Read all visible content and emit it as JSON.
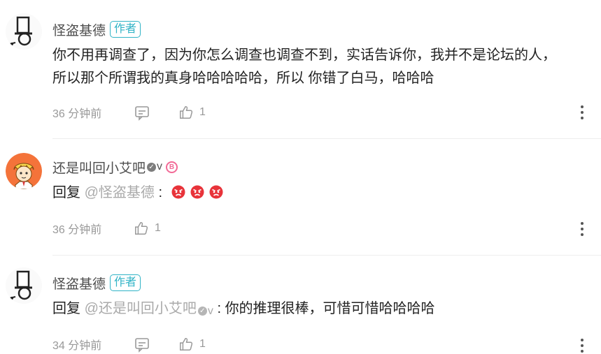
{
  "comments": [
    {
      "author": "怪盗基德",
      "badge": "作者",
      "text_line1": "你不用再调查了，因为你怎么调查也调查不到，实话告诉你，我并不是论坛的人，",
      "text_line2": "所以那个所谓我的真身哈哈哈哈哈，所以 你错了白马，哈哈哈",
      "time": "36 分钟前",
      "likes": "1"
    },
    {
      "author": "还是叫回小艾吧",
      "v_mark": "v",
      "level_badge": "B",
      "reply_prefix": "回复",
      "mention": "@怪盗基德",
      "separator": ":",
      "emoji_count": 3,
      "emoji_icon": "angry-face-icon",
      "time": "36 分钟前",
      "likes": "1"
    },
    {
      "author": "怪盗基德",
      "badge": "作者",
      "reply_prefix": "回复",
      "mention": "@还是叫回小艾吧",
      "mention_v": "v",
      "separator": ":",
      "text": "你的推理很棒，可惜可惜哈哈哈哈",
      "time": "34 分钟前",
      "likes": "1"
    }
  ],
  "colors": {
    "badge": "#30b3c6",
    "level_badge": "#f26a97",
    "mention": "#aaaaaa",
    "meta": "#999999",
    "emoji": "#e8333a"
  }
}
